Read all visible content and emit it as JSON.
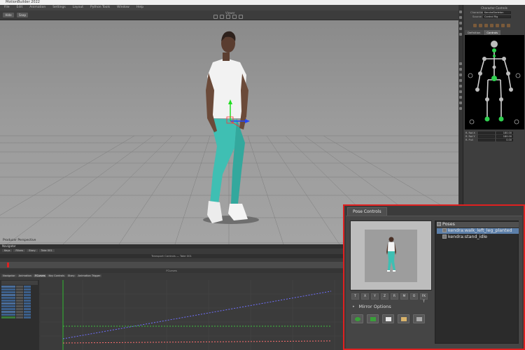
{
  "app": {
    "title": "MotionBuilder 2022",
    "menu": [
      "File",
      "Edit",
      "Animation",
      "Settings",
      "Layout",
      "Python Tools",
      "Window",
      "Help"
    ]
  },
  "toolbar": {
    "viewer_label": "Viewer",
    "button_a": "Hide",
    "button_b": "Snap"
  },
  "viewport": {
    "camera_label": "Producer Perspective"
  },
  "character_controls": {
    "title": "Character Controls",
    "character_label": "Character",
    "character_value": "KendraSkeleton",
    "source_label": "Source",
    "source_value": "Control Rig",
    "tabs": [
      "Definition",
      "Controls"
    ],
    "dof_rows": [
      {
        "name": "R. Rot X",
        "value": "180.00"
      },
      {
        "name": "R. Rot Y",
        "value": "180.00"
      },
      {
        "name": "R. Pull",
        "value": "0.00"
      }
    ]
  },
  "timeline": {
    "header": "Navigator",
    "tabs": [
      "Keys",
      "Filters",
      "Story",
      "Take 001"
    ],
    "transport_label": "Transport Controls — Take 001",
    "curve_header": "FCurves",
    "fcurve_tabs": [
      "Navigator",
      "Animation",
      "FCurves",
      "Key Controls",
      "Story",
      "Animation Trigger"
    ]
  },
  "pose_controls": {
    "tab_label": "Pose Controls",
    "mirror_label": "Mirror Options",
    "preview_buttons": [
      "T",
      "X",
      "Y",
      "Z",
      "R",
      "M",
      "O",
      "FK T"
    ],
    "tree": {
      "root": "Poses",
      "items": [
        {
          "label": "kendra:walk_left_leg_planted",
          "selected": true
        },
        {
          "label": "kendra:stand_idle",
          "selected": false
        }
      ]
    }
  },
  "colors": {
    "selection": "#5c7fa9",
    "highlight_border": "#e02020",
    "leggings": "#3fbfb3",
    "shirt": "#f2f2f2"
  }
}
